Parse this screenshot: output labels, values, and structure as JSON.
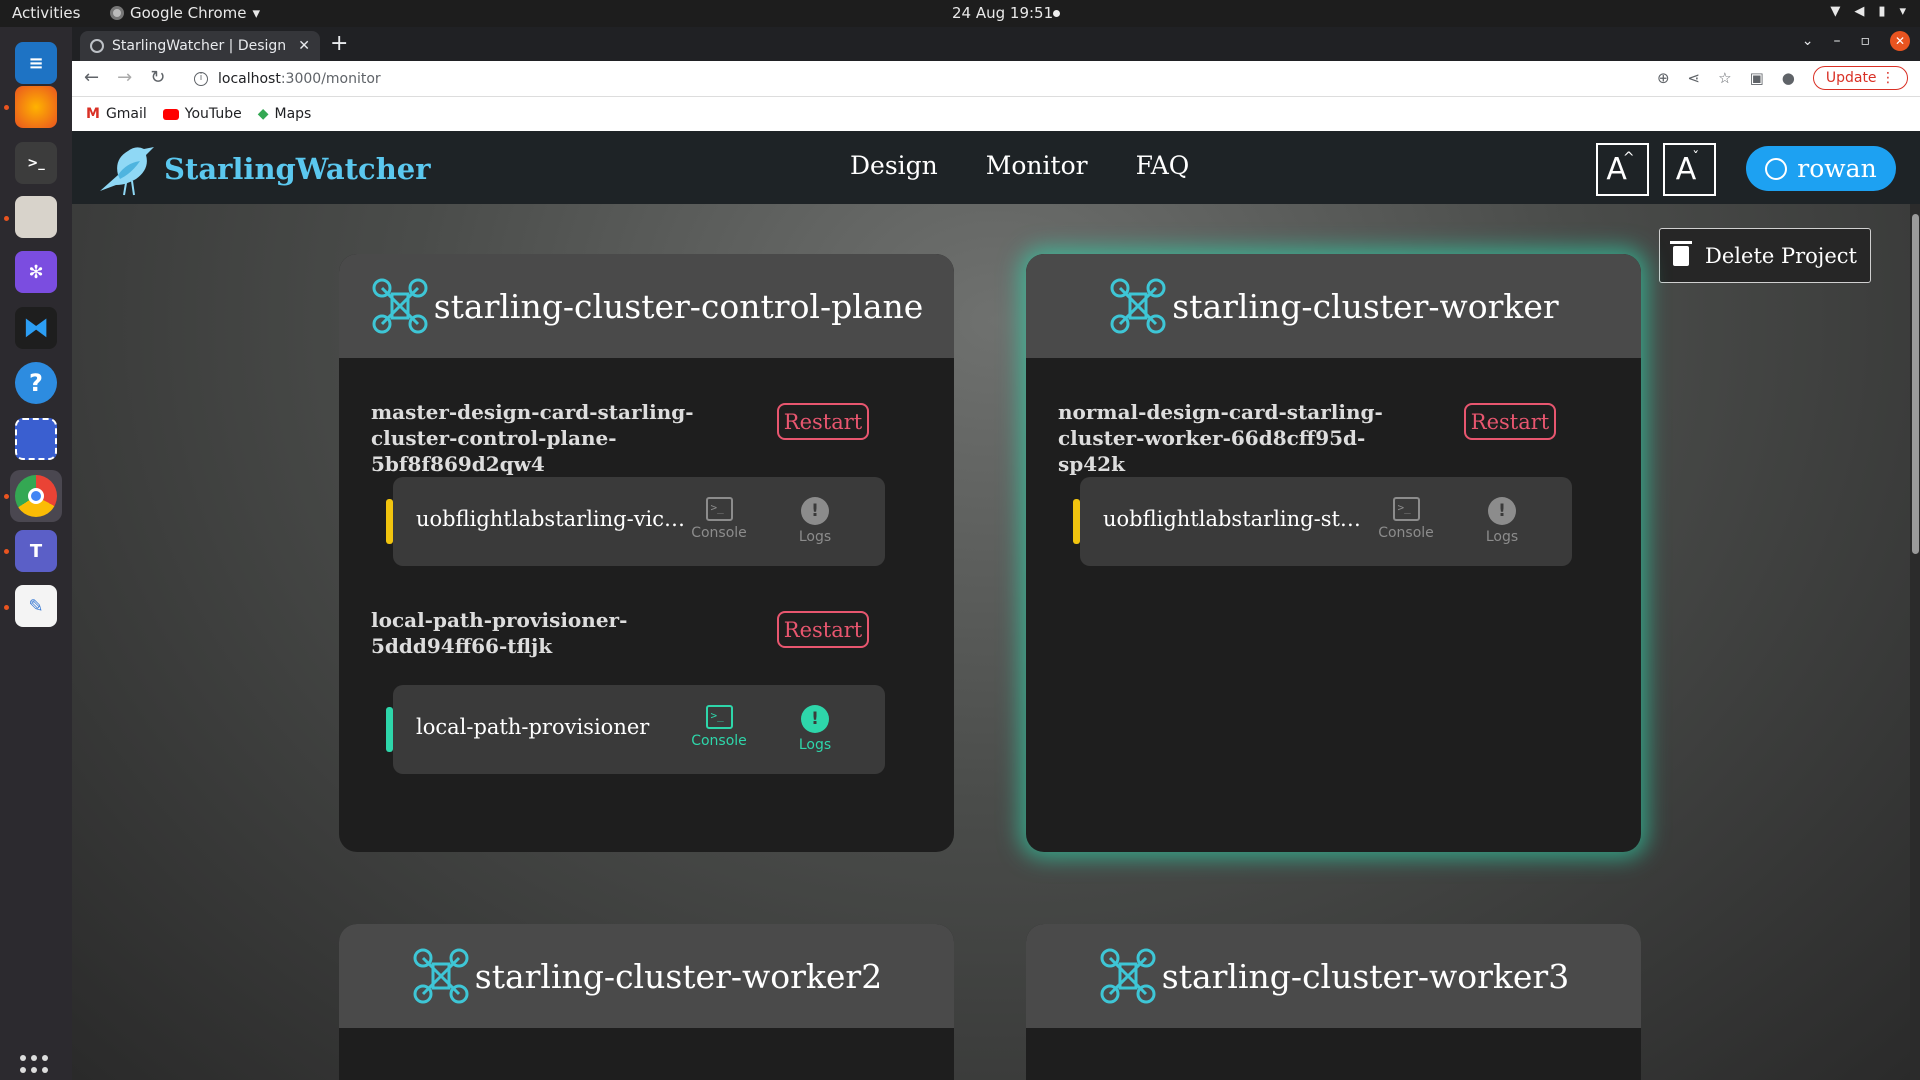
{
  "os": {
    "activities": "Activities",
    "app_menu": "Google Chrome",
    "clock": "24 Aug  19:51"
  },
  "browser": {
    "tab_title": "StarlingWatcher | Design",
    "url_host": "localhost",
    "url_path": ":3000/monitor",
    "update_label": "Update",
    "bookmarks": [
      "Gmail",
      "YouTube",
      "Maps"
    ]
  },
  "app": {
    "brand": "StarlingWatcher",
    "nav": [
      "Design",
      "Monitor",
      "FAQ"
    ],
    "font_increase": "A",
    "font_decrease": "A",
    "user": "rowan",
    "delete_project": "Delete Project",
    "restart_label": "Restart",
    "console_label": "Console",
    "logs_label": "Logs",
    "accent": "#2ed6aa",
    "restart_color": "#e8566f",
    "warning_color": "#f1c40f"
  },
  "cards": [
    {
      "name": "starling-cluster-control-plane",
      "pods": [
        {
          "name": "master-design-card-starling-cluster-control-plane-5bf8f869d2qw4",
          "containers": [
            {
              "name": "uobflightlabstarling-vicon-…",
              "status": "warning"
            }
          ]
        },
        {
          "name": "local-path-provisioner-5ddd94ff66-tfljk",
          "containers": [
            {
              "name": "local-path-provisioner",
              "status": "running"
            }
          ]
        }
      ]
    },
    {
      "name": "starling-cluster-worker",
      "pods": [
        {
          "name": "normal-design-card-starling-cluster-worker-66d8cff95d-sp42k",
          "containers": [
            {
              "name": "uobflightlabstarling-starlin…",
              "status": "warning"
            }
          ]
        }
      ]
    },
    {
      "name": "starling-cluster-worker2",
      "pods": []
    },
    {
      "name": "starling-cluster-worker3",
      "pods": []
    }
  ]
}
